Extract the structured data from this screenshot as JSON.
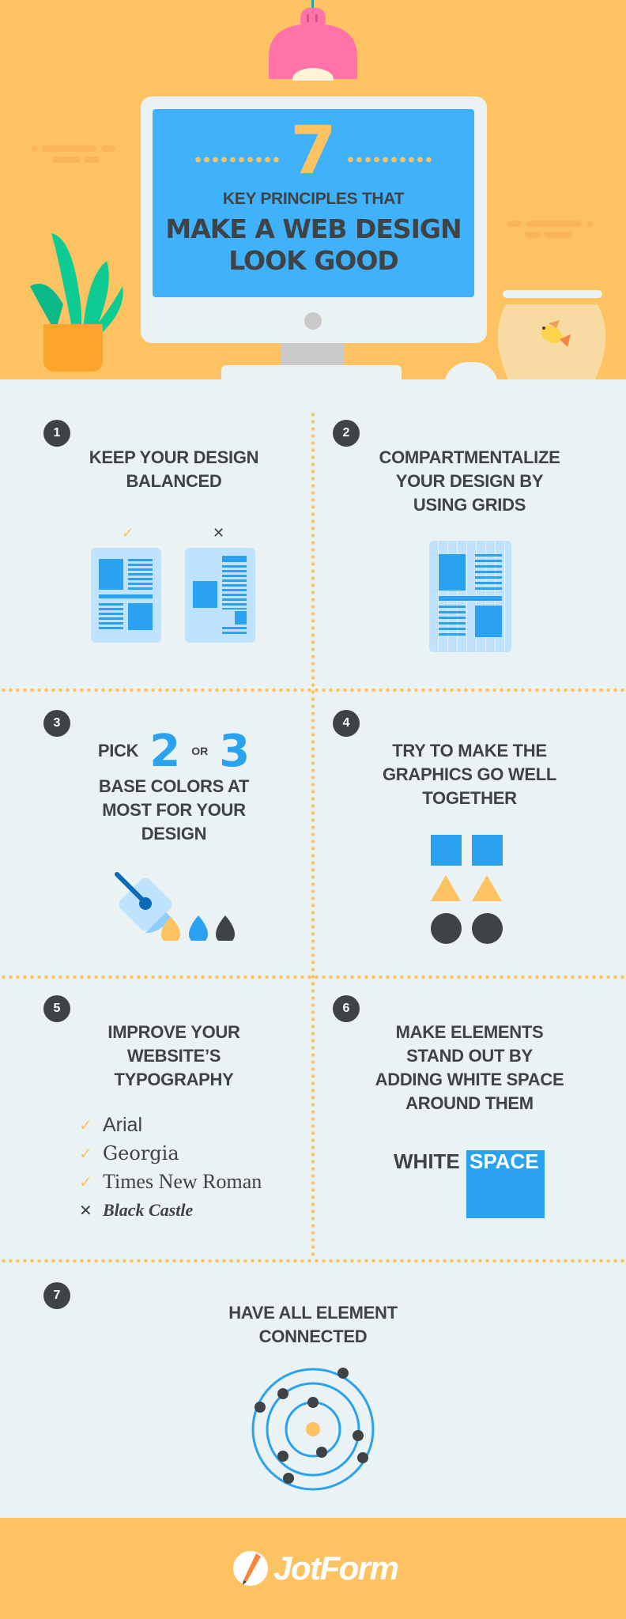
{
  "hero": {
    "number": "7",
    "subtitle": "KEY PRINCIPLES THAT",
    "headline_line1": "MAKE A WEB DESIGN",
    "headline_line2": "LOOK GOOD"
  },
  "principles": [
    {
      "number": "1",
      "title_lines": [
        "KEEP YOUR DESIGN",
        "BALANCED"
      ],
      "good_mark": "✓",
      "bad_mark": "✕"
    },
    {
      "number": "2",
      "title_lines": [
        "COMPARTMENTALIZE",
        "YOUR DESIGN BY",
        "USING GRIDS"
      ]
    },
    {
      "number": "3",
      "title_prefix": "PICK",
      "num_a": "2",
      "or": "OR",
      "num_b": "3",
      "title_lines": [
        "BASE COLORS AT",
        "MOST FOR YOUR",
        "DESIGN"
      ]
    },
    {
      "number": "4",
      "title_lines": [
        "TRY TO MAKE THE",
        "GRAPHICS GO WELL",
        "TOGETHER"
      ]
    },
    {
      "number": "5",
      "title_lines": [
        "IMPROVE YOUR",
        "WEBSITE’S",
        "TYPOGRAPHY"
      ],
      "fonts": [
        {
          "mark": "✓",
          "name": "Arial",
          "ok": true
        },
        {
          "mark": "✓",
          "name": "Georgia",
          "ok": true
        },
        {
          "mark": "✓",
          "name": "Times New Roman",
          "ok": true
        },
        {
          "mark": "✕",
          "name": "Black Castle",
          "ok": false
        }
      ]
    },
    {
      "number": "6",
      "title_lines": [
        "MAKE ELEMENTS",
        "STAND OUT BY",
        "ADDING WHITE SPACE",
        "AROUND THEM"
      ],
      "word_a": "WHITE",
      "word_b": "SPACE"
    },
    {
      "number": "7",
      "title_lines": [
        "HAVE ALL ELEMENT",
        "CONNECTED"
      ]
    }
  ],
  "footer": {
    "brand": "JotForm"
  },
  "colors": {
    "accent_yellow": "#fdc363",
    "blue": "#2aa2f0",
    "dark": "#3f4345",
    "background": "#ebf2f3",
    "pink": "#ff73a8",
    "green": "#0ccc93"
  }
}
